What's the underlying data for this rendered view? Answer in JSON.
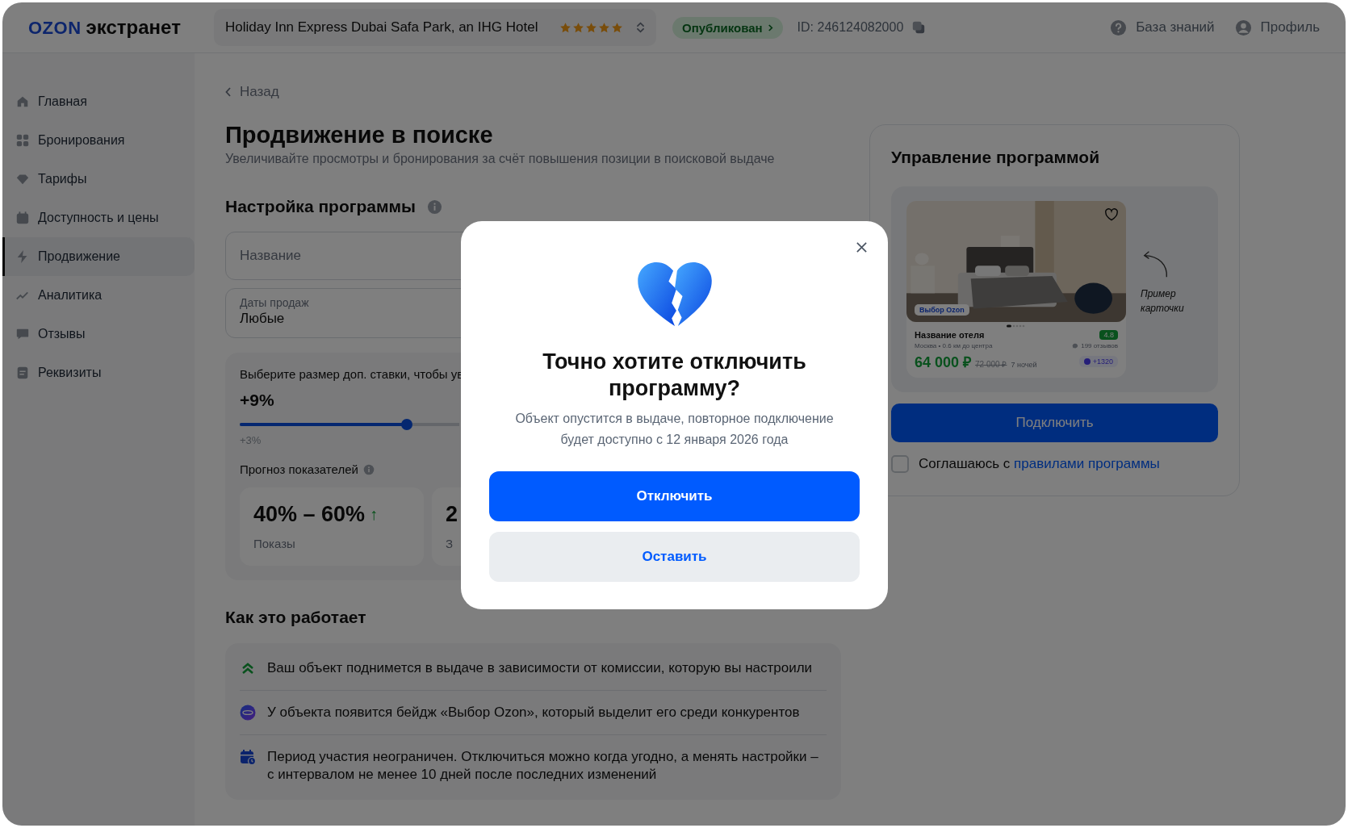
{
  "header": {
    "logo_mark": "OZON",
    "logo_text": "экстранет",
    "hotel": {
      "name": "Holiday Inn Express Dubai Safa Park, an IHG Hotel",
      "stars": 5
    },
    "status": "Опубликован",
    "id": "ID: 246124082000",
    "links": [
      {
        "label": "База знаний",
        "kind": "help"
      },
      {
        "label": "Профиль",
        "kind": "profile"
      }
    ]
  },
  "sidebar": {
    "items": [
      {
        "label": "Главная",
        "kind": "home",
        "selected": false
      },
      {
        "label": "Бронирования",
        "kind": "grid",
        "selected": false
      },
      {
        "label": "Тарифы",
        "kind": "diamond",
        "selected": false
      },
      {
        "label": "Доступность и цены",
        "kind": "calendar",
        "selected": false
      },
      {
        "label": "Продвижение",
        "kind": "bolt",
        "selected": true
      },
      {
        "label": "Аналитика",
        "kind": "chart",
        "selected": false
      },
      {
        "label": "Отзывы",
        "kind": "chat",
        "selected": false
      },
      {
        "label": "Реквизиты",
        "kind": "doc",
        "selected": false
      }
    ]
  },
  "page": {
    "back": "Назад",
    "title": "Продвижение в поиске",
    "subtitle": "Увеличивайте просмотры и бронирования за счёт повышения позиции в поисковой выдаче"
  },
  "settings": {
    "title": "Настройка программы",
    "name_field": {
      "placeholder": "Название"
    },
    "dates_field": {
      "label": "Даты продаж",
      "value": "Любые"
    },
    "bid": {
      "prompt": "Выберите размер доп. ставки, чтобы ув",
      "value": "+9%",
      "level": 0.76,
      "min_label": "+3%"
    },
    "forecast": {
      "title": "Прогноз показателей",
      "metrics": [
        {
          "value": "40% – 60%",
          "arrow": "↑",
          "caption": "Показы"
        },
        {
          "value": "2",
          "caption": "З"
        }
      ]
    }
  },
  "how_it_works": {
    "title": "Как это работает",
    "items": [
      {
        "kind": "chevrons",
        "text": "Ваш объект поднимется в выдаче в зависимости от комиссии, которую вы настроили"
      },
      {
        "kind": "badge",
        "text": "У объекта появится бейдж «Выбор Ozon», который выделит его среди конкурентов"
      },
      {
        "kind": "calendar",
        "text": "Период участия неограничен. Отключиться можно когда угодно, а менять настройки – с интервалом не менее 10 дней после последних изменений"
      }
    ]
  },
  "program_panel": {
    "title": "Управление программой",
    "sample": {
      "badge": "Выбор Ozon",
      "name": "Название отеля",
      "rating": "4.8",
      "location": "Москва • 0.6 км до центра",
      "reviews": "199 отзывов",
      "price": "64 000 ₽",
      "old_price": "72 000 ₽",
      "nights": "7 ночей",
      "bonus": "+1320"
    },
    "sample_note": "Пример карточки",
    "button": "Подключить",
    "agree": {
      "checked": false,
      "text": "Соглашаюсь с ",
      "link": "правилами программы"
    }
  },
  "modal": {
    "title": "Точно хотите отключить программу?",
    "text": "Объект опустится в выдаче, повторное подключение будет доступно с 12 января 2026 года",
    "confirm": "Отключить",
    "cancel": "Оставить"
  }
}
